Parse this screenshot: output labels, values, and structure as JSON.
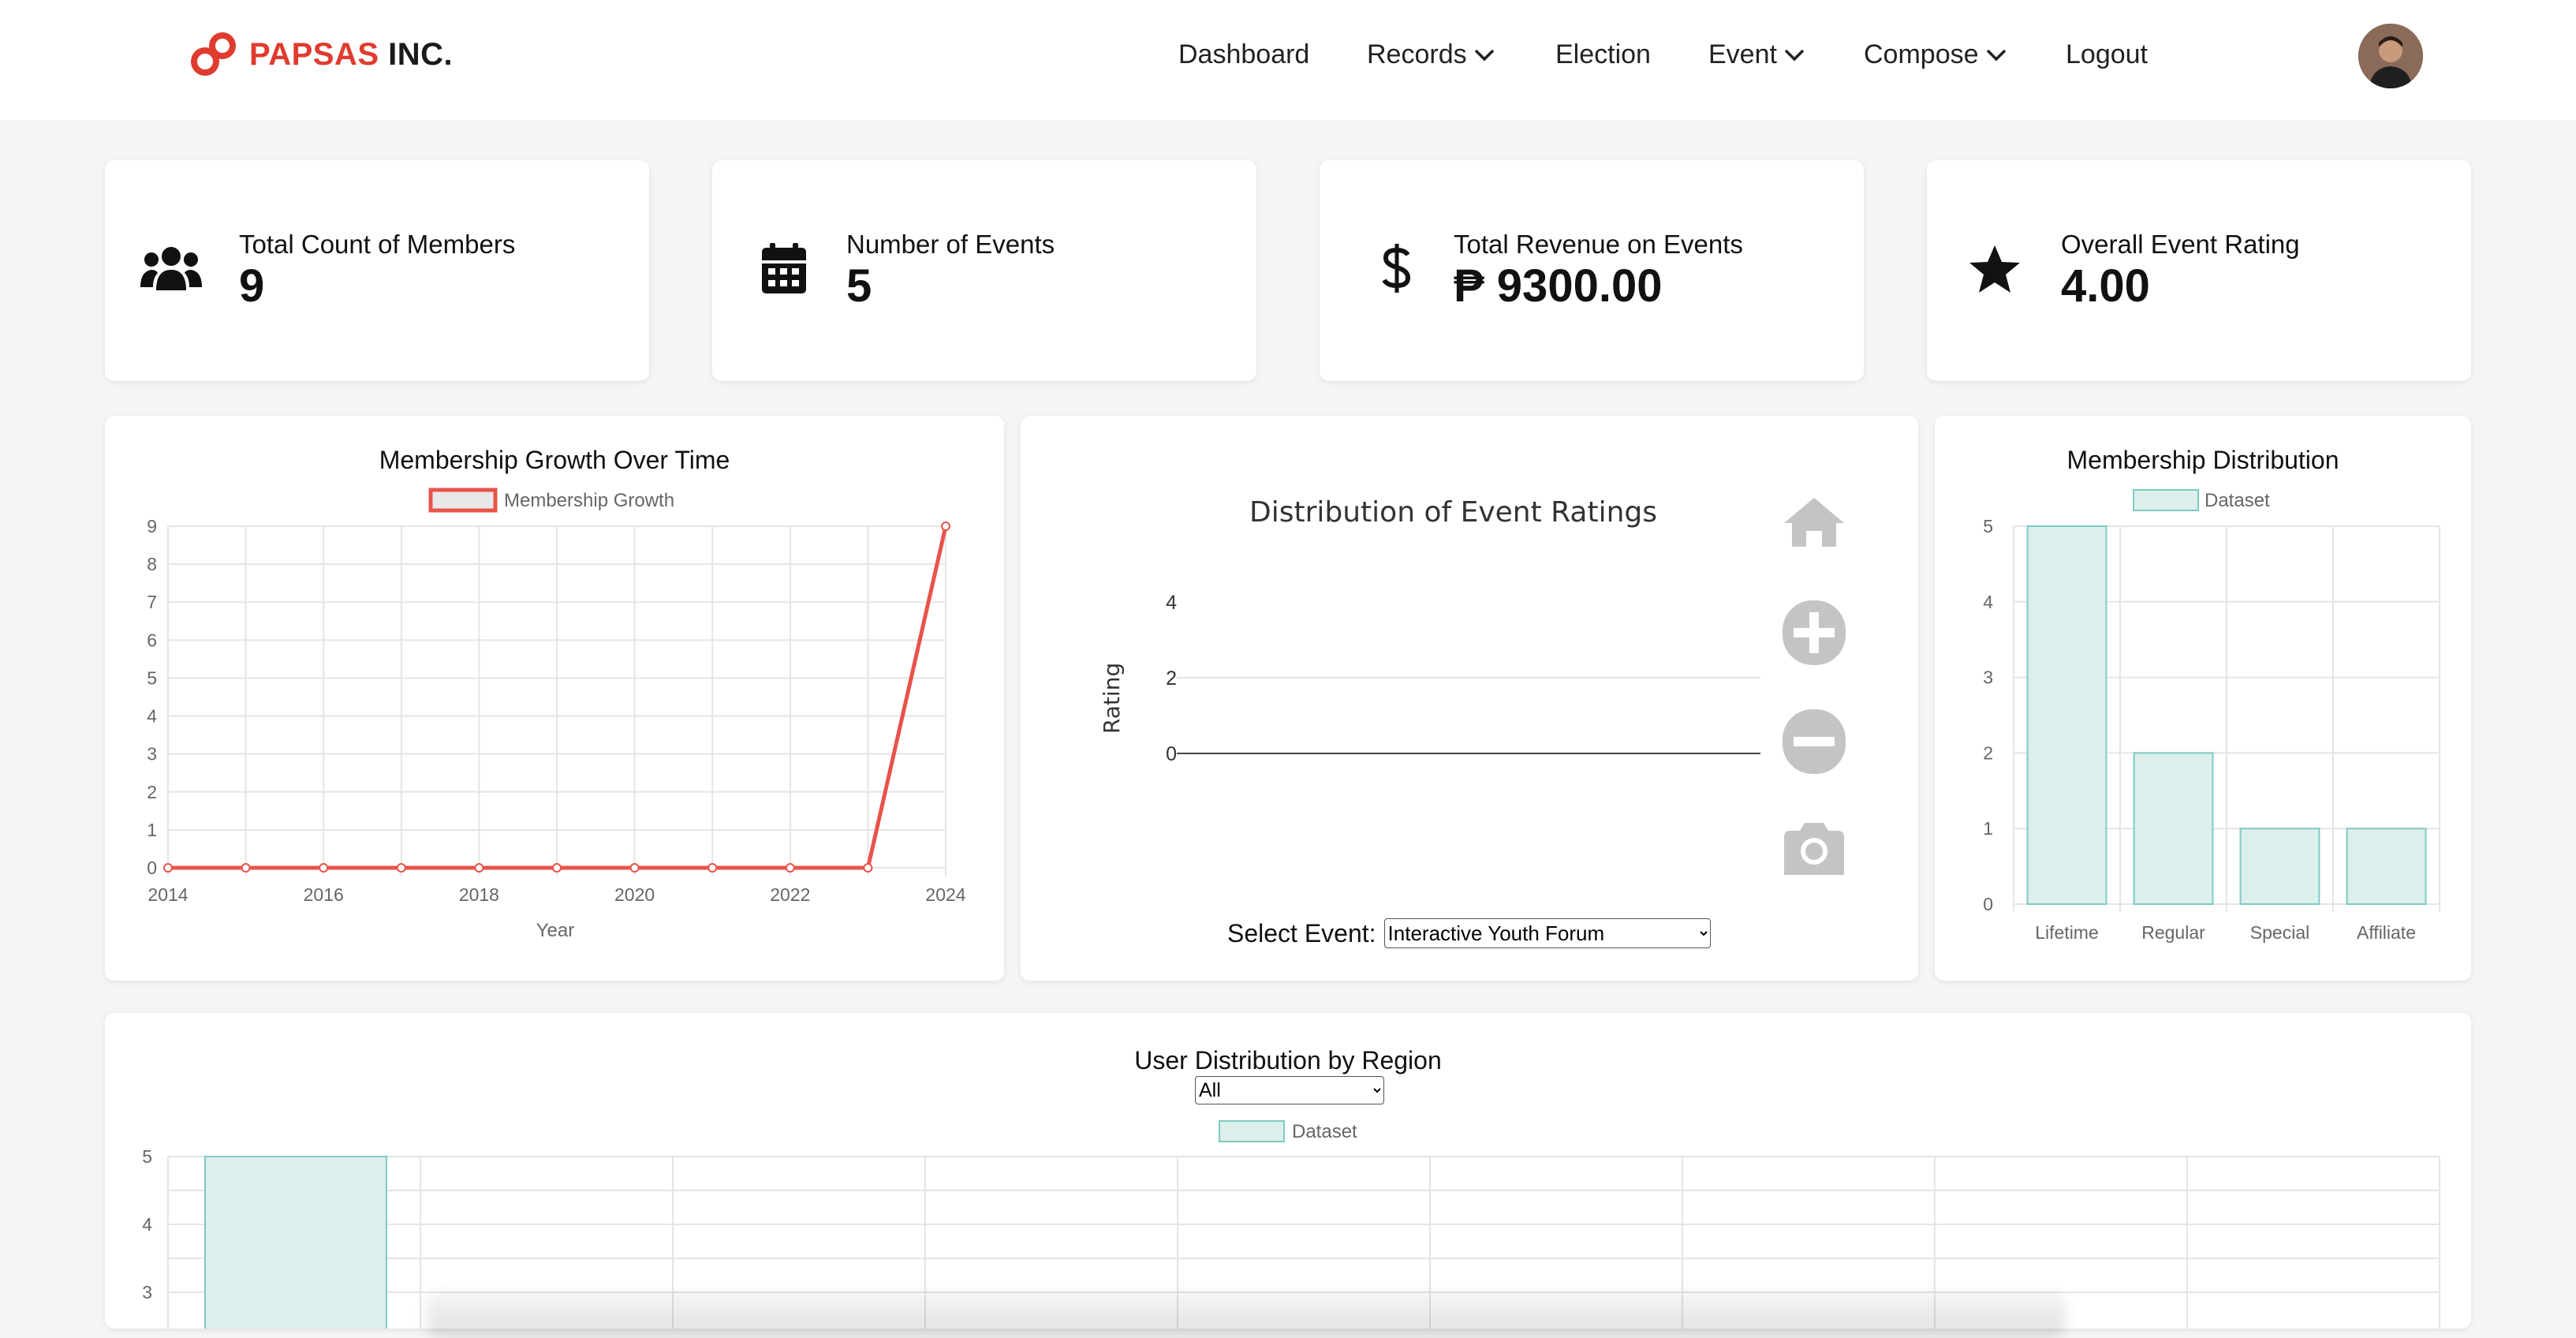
{
  "brand": {
    "name_red": "PAPSAS",
    "name_dark": "INC.",
    "color": "#e03b2f"
  },
  "nav": {
    "dashboard": "Dashboard",
    "records": "Records",
    "election": "Election",
    "event": "Event",
    "compose": "Compose",
    "logout": "Logout"
  },
  "stats": [
    {
      "label": "Total Count of Members",
      "value": "9",
      "icon": "users-icon"
    },
    {
      "label": "Number of Events",
      "value": "5",
      "icon": "calendar-icon"
    },
    {
      "label": "Total Revenue on Events",
      "value": "₱ 9300.00",
      "icon": "dollar-icon"
    },
    {
      "label": "Overall Event Rating",
      "value": "4.00",
      "icon": "star-icon"
    }
  ],
  "event_ratings": {
    "title": "Distribution of Event Ratings",
    "ylabel": "Rating",
    "y_ticks": [
      "4",
      "2",
      "0"
    ],
    "select_label": "Select Event:",
    "selected_event": "Interactive Youth Forum",
    "toolbar_icons": [
      "home-icon",
      "zoom-in-icon",
      "zoom-out-icon",
      "camera-icon"
    ]
  },
  "region": {
    "title": "User Distribution by Region",
    "selected": "All"
  },
  "chart_data": [
    {
      "type": "line",
      "title": "Membership Growth Over Time",
      "xlabel": "Year",
      "ylabel": "",
      "x": [
        2014,
        2015,
        2016,
        2017,
        2018,
        2019,
        2020,
        2021,
        2022,
        2023,
        2024
      ],
      "x_ticks": [
        "2014",
        "2016",
        "2018",
        "2020",
        "2022",
        "2024"
      ],
      "series": [
        {
          "name": "Membership Growth",
          "values": [
            0,
            0,
            0,
            0,
            0,
            0,
            0,
            0,
            0,
            0,
            9
          ]
        }
      ],
      "ylim": [
        0,
        9
      ],
      "y_ticks": [
        "0",
        "1",
        "2",
        "3",
        "4",
        "5",
        "6",
        "7",
        "8",
        "9"
      ],
      "color": "#e8534a",
      "grid": true,
      "legend": "top"
    },
    {
      "type": "bar",
      "title": "Membership Distribution",
      "categories": [
        "Lifetime",
        "Regular",
        "Special",
        "Affiliate"
      ],
      "series": [
        {
          "name": "Dataset",
          "values": [
            5,
            2,
            1,
            1
          ]
        }
      ],
      "ylim": [
        0,
        5
      ],
      "y_ticks": [
        "0",
        "1",
        "2",
        "3",
        "4",
        "5"
      ],
      "color": "#7fcac3",
      "grid": true,
      "legend": "top"
    },
    {
      "type": "bar",
      "title": "User Distribution by Region",
      "categories": [],
      "series": [
        {
          "name": "Dataset",
          "values": [
            5
          ]
        }
      ],
      "y_ticks_visible": [
        "5",
        "4",
        "3"
      ],
      "color": "#7fcac3",
      "grid": true,
      "legend": "top"
    }
  ]
}
